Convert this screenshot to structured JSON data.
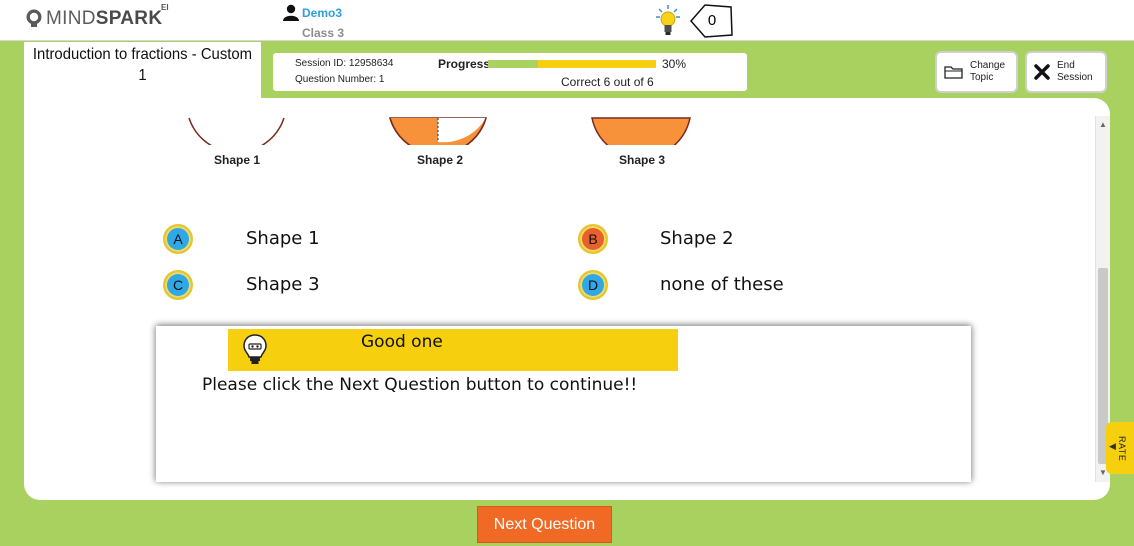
{
  "header": {
    "logo_text_light": "MIND",
    "logo_text_bold": "SPARK",
    "logo_superscript": "EI",
    "user_name": "Demo3",
    "user_class": "Class 3",
    "sparkie_count": "0"
  },
  "topic": {
    "title_line1": "Introduction to fractions - Custom",
    "title_line2": "1"
  },
  "session": {
    "session_id": "Session ID: 12958634",
    "question_number": "Question Number: 1",
    "progress_label": "Progress",
    "progress_fraction": 0.3,
    "progress_percent": "30%",
    "correct_text": "Correct  6  out of  6"
  },
  "actions": {
    "change_topic_line1": "Change",
    "change_topic_line2": "Topic",
    "end_session_line1": "End",
    "end_session_line2": "Session"
  },
  "shapes": {
    "labels": [
      "Shape 1",
      "Shape 2",
      "Shape 3"
    ],
    "fill_color": "#f7913a",
    "stroke_color": "#7a2b1f"
  },
  "options": [
    {
      "letter": "A",
      "text": "Shape 1",
      "color": "#2ea8e6"
    },
    {
      "letter": "B",
      "text": "Shape 2",
      "color": "#e8602c"
    },
    {
      "letter": "C",
      "text": "Shape 3",
      "color": "#2ea8e6"
    },
    {
      "letter": "D",
      "text": "none of these",
      "color": "#2ea8e6"
    }
  ],
  "feedback": {
    "title": "Good one",
    "message": "Please click the Next Question button to continue!!"
  },
  "rate_label": "RATE",
  "next_button": "Next Question",
  "colors": {
    "frame_green": "#a9d160",
    "banner_yellow": "#f6d00e",
    "next_orange": "#f06a26",
    "user_blue": "#2e9fd9"
  }
}
